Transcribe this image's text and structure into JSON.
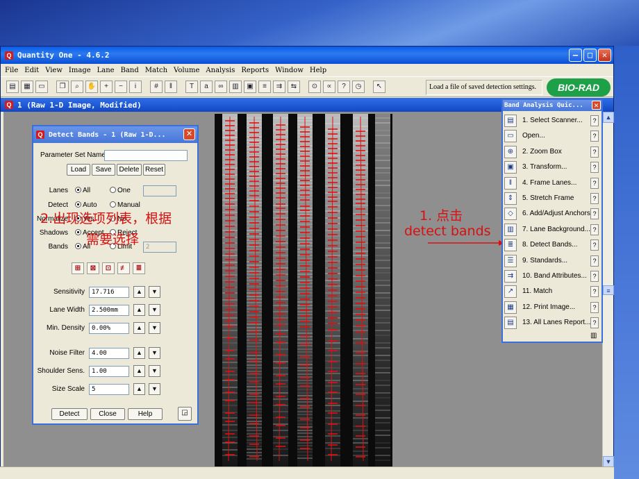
{
  "app": {
    "title": "Quantity One - 4.6.2",
    "menu": [
      "File",
      "Edit",
      "View",
      "Image",
      "Lane",
      "Band",
      "Match",
      "Volume",
      "Analysis",
      "Reports",
      "Window",
      "Help"
    ],
    "status_message": "Load a file of saved detection settings.",
    "logo_text": "BIO-RAD",
    "document_title": "1 (Raw 1-D Image, Modified)"
  },
  "detect_dialog": {
    "title": "Detect Bands - 1 (Raw 1-D...",
    "param_set_label": "Parameter Set Name",
    "param_set_value": "",
    "buttons": {
      "load": "Load",
      "save": "Save",
      "delete": "Delete",
      "reset": "Reset"
    },
    "lanes": {
      "label": "Lanes",
      "opt1": "All",
      "opt2": "One"
    },
    "detect": {
      "label": "Detect",
      "opt1": "Auto",
      "opt2": "Manual"
    },
    "normalize": {
      "label": "Normalize",
      "opt1": "Yes",
      "opt2": "No"
    },
    "shadows": {
      "label": "Shadows",
      "opt1": "Accept",
      "opt2": "Reject"
    },
    "bands": {
      "label": "Bands",
      "opt1": "All",
      "opt2": "Limit",
      "limit_value": "2"
    },
    "sensitivity": {
      "label": "Sensitivity",
      "value": "17.716"
    },
    "lane_width": {
      "label": "Lane Width",
      "value": "2.500mm"
    },
    "min_density": {
      "label": "Min. Density",
      "value": "0.00%"
    },
    "noise_filter": {
      "label": "Noise Filter",
      "value": "4.00"
    },
    "shoulder_sens": {
      "label": "Shoulder Sens.",
      "value": "1.00"
    },
    "size_scale": {
      "label": "Size Scale",
      "value": "5"
    },
    "footer": {
      "detect": "Detect",
      "close": "Close",
      "help": "Help"
    }
  },
  "annotations": {
    "note2_line1": "2.出现选项列表，根据",
    "note2_line2": "需要选择",
    "note1_line1": "1.  点击",
    "note1_line2": "detect bands"
  },
  "band_panel": {
    "title": "Band Analysis Quic...",
    "items": [
      {
        "label": "1.   Select Scanner...",
        "icon": "scanner-icon"
      },
      {
        "label": "Open...",
        "icon": "open-folder-icon"
      },
      {
        "label": "2.   Zoom Box",
        "icon": "zoom-icon"
      },
      {
        "label": "3.   Transform...",
        "icon": "transform-icon"
      },
      {
        "label": "4.   Frame Lanes...",
        "icon": "frame-lanes-icon"
      },
      {
        "label": "5.   Stretch Frame",
        "icon": "stretch-frame-icon"
      },
      {
        "label": "6.   Add/Adjust Anchors",
        "icon": "anchors-icon"
      },
      {
        "label": "7.   Lane Background...",
        "icon": "lane-background-icon"
      },
      {
        "label": "8.   Detect Bands...",
        "icon": "detect-bands-icon"
      },
      {
        "label": "9.   Standards...",
        "icon": "standards-icon"
      },
      {
        "label": "10.  Band Attributes...",
        "icon": "band-attributes-icon"
      },
      {
        "label": "11.  Match",
        "icon": "match-icon"
      },
      {
        "label": "12.  Print Image...",
        "icon": "printer-icon"
      },
      {
        "label": "13.  All Lanes Report...",
        "icon": "report-icon"
      }
    ],
    "help_glyph": "?"
  },
  "colors": {
    "annotation_red": "#d81010",
    "band_marker_red": "#e01010",
    "titlebar_blue": "#0a5ce8",
    "logo_green": "#1ea049"
  }
}
